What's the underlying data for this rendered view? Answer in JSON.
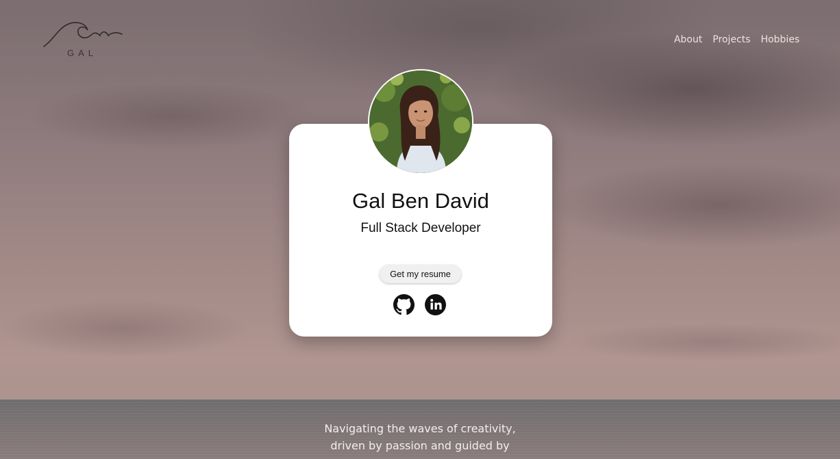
{
  "header": {
    "logo_text": "GAL",
    "nav": [
      {
        "label": "About"
      },
      {
        "label": "Projects"
      },
      {
        "label": "Hobbies"
      }
    ]
  },
  "profile": {
    "name": "Gal Ben David",
    "role": "Full Stack Developer",
    "resume_button": "Get my resume",
    "social": [
      {
        "icon": "github-icon"
      },
      {
        "icon": "linkedin-icon"
      }
    ]
  },
  "tagline": {
    "lines": [
      "Navigating the waves of creativity,",
      "driven by passion and guided by"
    ]
  }
}
